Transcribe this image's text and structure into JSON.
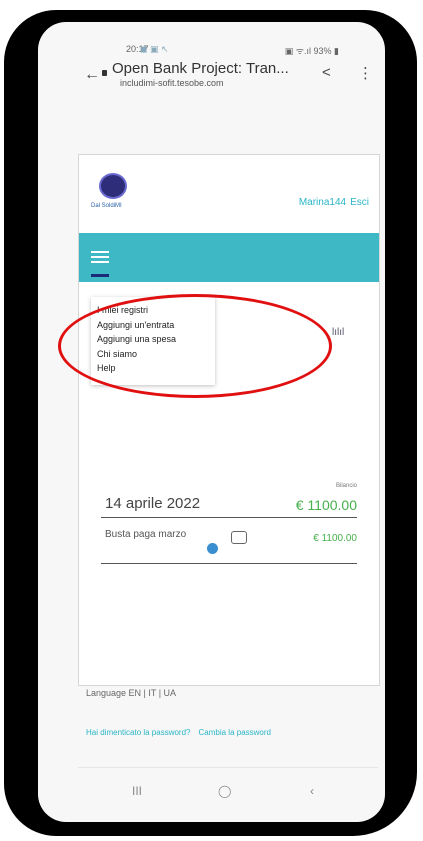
{
  "status_bar": {
    "time": "20:17",
    "status_icons": "◼ ▣ ↖",
    "right": "▣ ᯤ.ıl 93% ▮"
  },
  "browser": {
    "back_glyph": "←",
    "page_title": "Open Bank Project: Tran...",
    "url": "includimi-sofit.tesobe.com",
    "share_glyph": "<",
    "menu_glyph": "⋮"
  },
  "header": {
    "logo_text": "Dal SoldiMI",
    "username": "Marina144",
    "logout_label": "Esci"
  },
  "nav_menu": {
    "items": [
      {
        "label": "I miei registri"
      },
      {
        "label": "Aggiungi un'entrata"
      },
      {
        "label": "Aggiungi una spesa"
      },
      {
        "label": "Chi siamo"
      },
      {
        "label": "Help"
      }
    ]
  },
  "chart_icon_glyph": "lılıl",
  "transactions": {
    "balance_label": "Bilancio",
    "date": "14 aprile 2022",
    "total": "€ 1100.00",
    "item": {
      "description": "Busta paga marzo",
      "amount": "€ 1100.00"
    }
  },
  "footer": {
    "language": "Language EN | IT | UA",
    "forgot_password": "Hai dimenticato la password?",
    "change_password": "Cambia la password"
  },
  "android_nav": {
    "recents": "III",
    "home": "◯",
    "back": "‹"
  },
  "colors": {
    "accent": "#3fb8c6",
    "positive": "#46b04b",
    "annotation": "#e11010"
  }
}
